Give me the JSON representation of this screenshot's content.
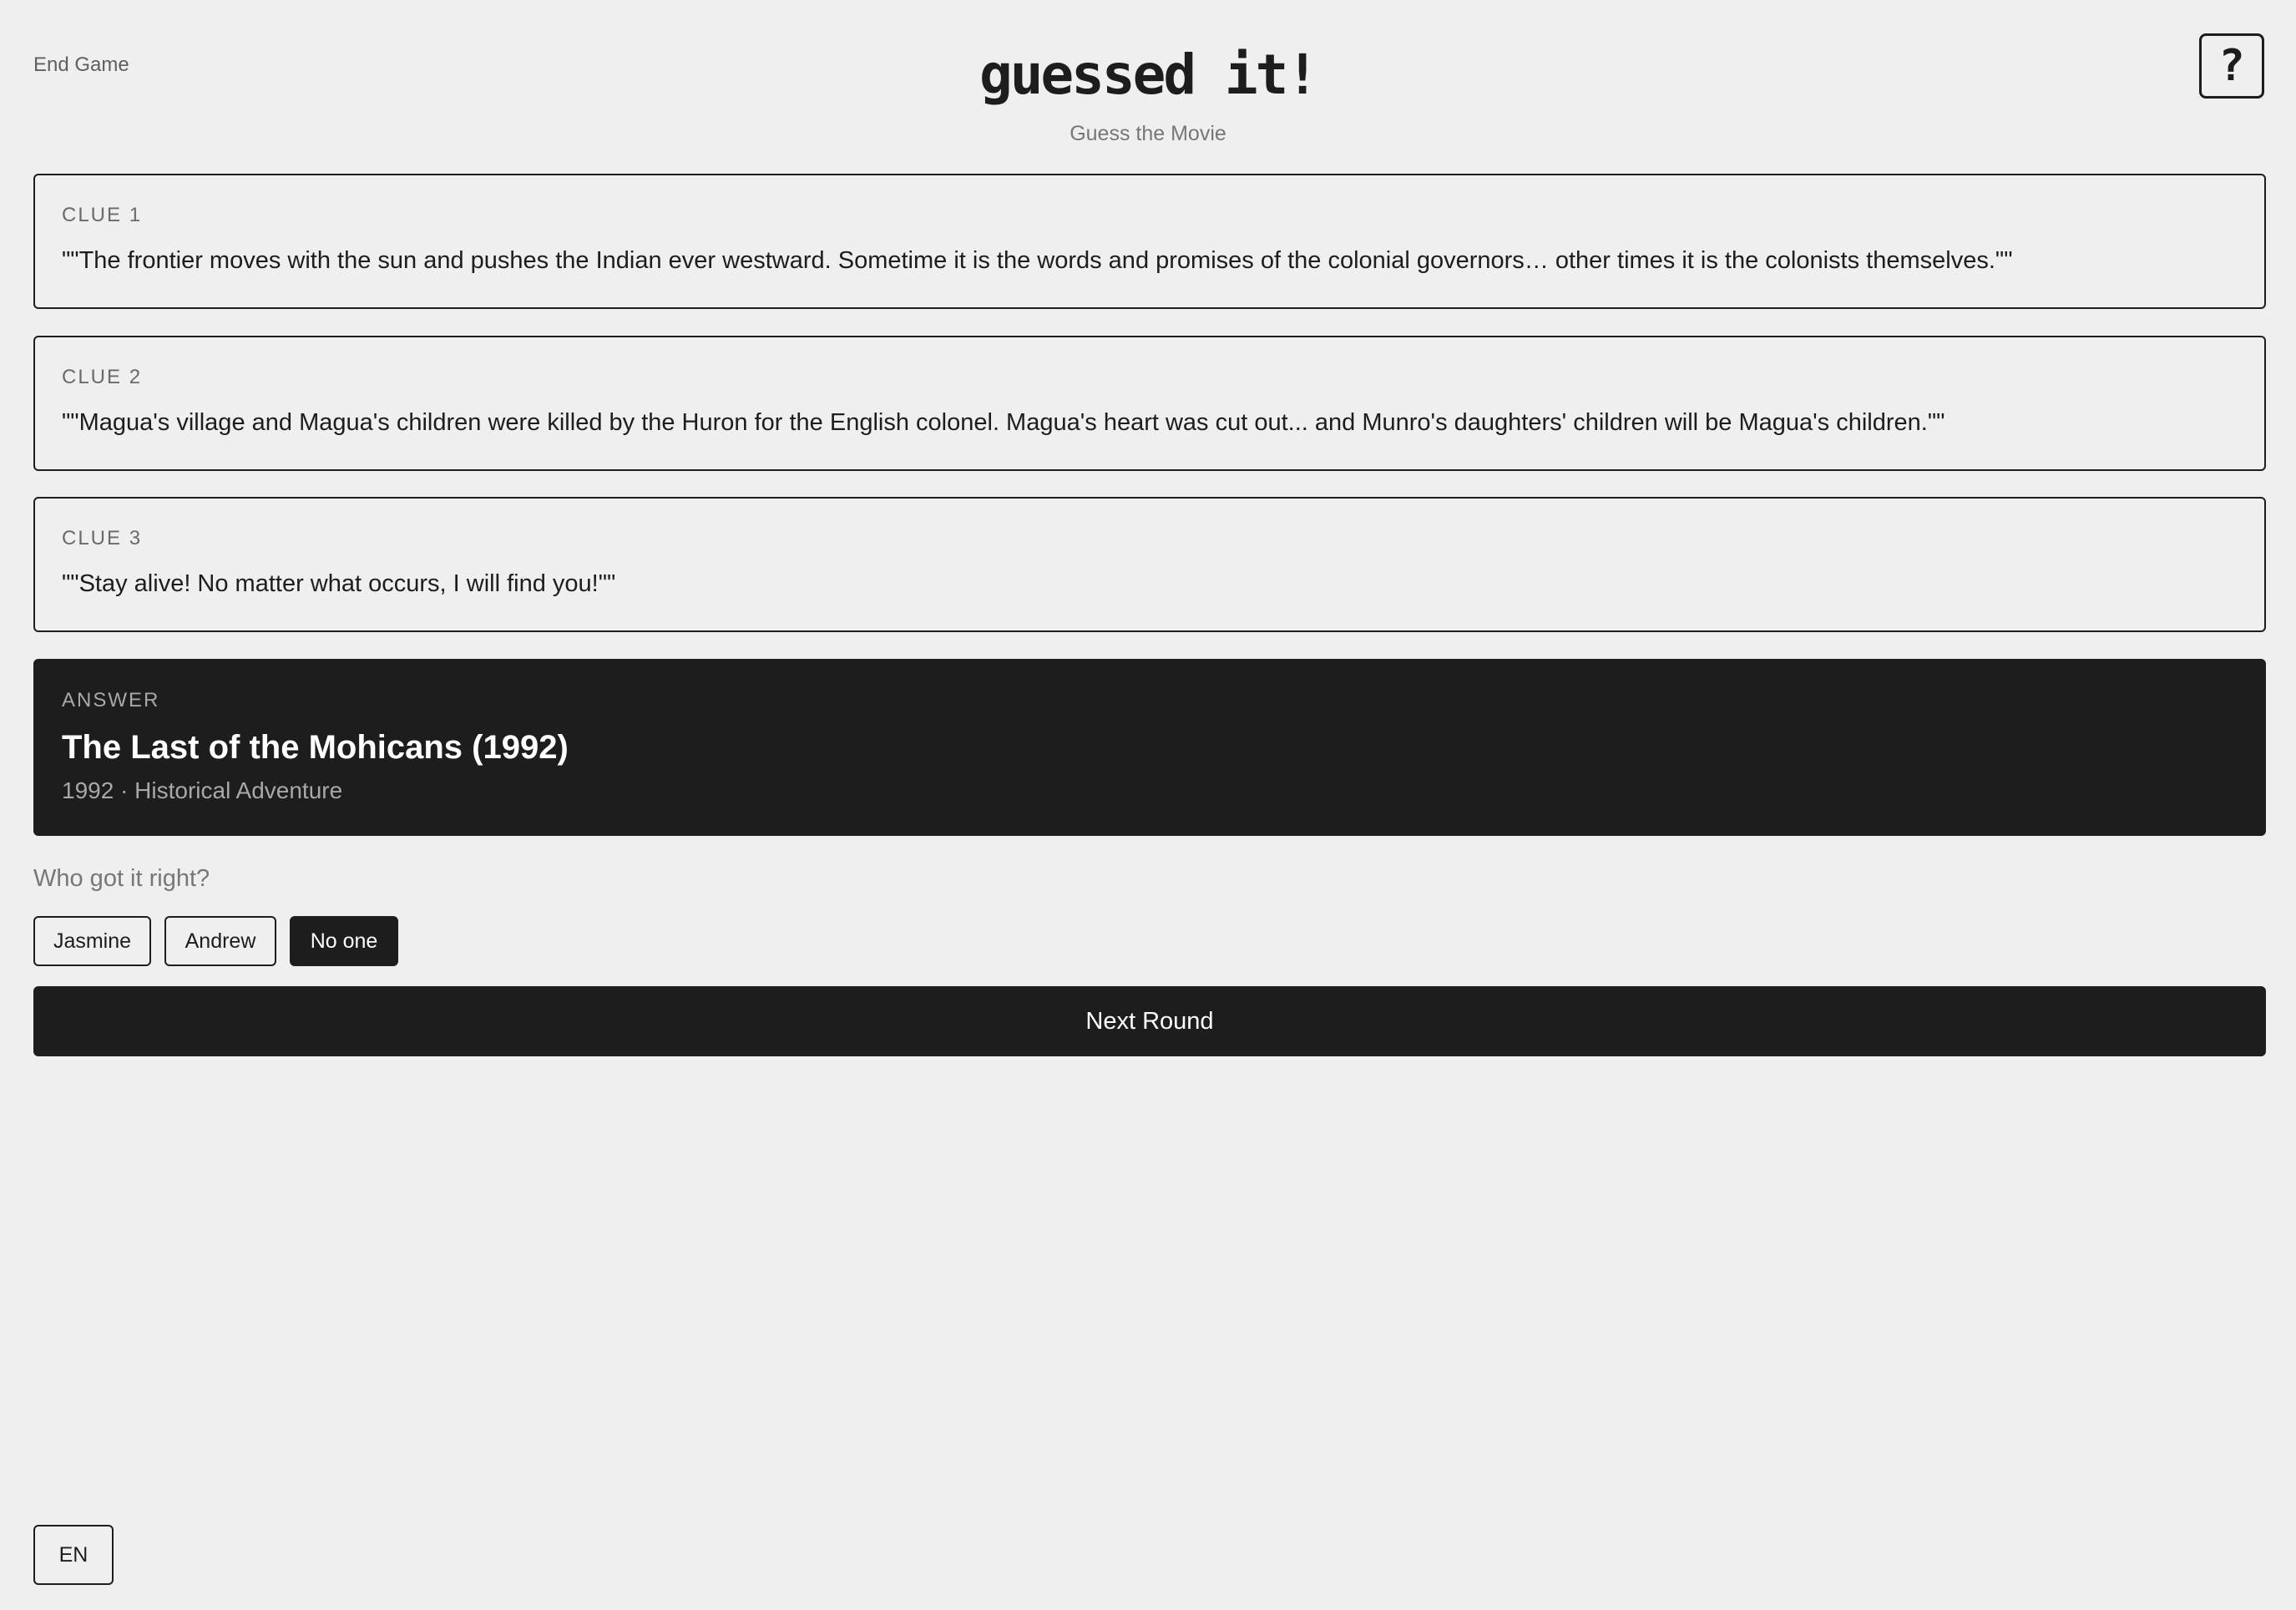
{
  "header": {
    "end_game_label": "End Game",
    "title": "guessed it!",
    "subtitle": "Guess the Movie",
    "help_label": "?"
  },
  "clues": [
    {
      "label": "CLUE 1",
      "text": "\"\"The frontier moves with the sun and pushes the Indian ever westward. Sometime it is the words and promises of the colonial governors… other times it is the colonists themselves.\"\""
    },
    {
      "label": "CLUE 2",
      "text": "\"\"Magua's village and Magua's children were killed by the Huron for the English colonel. Magua's heart was cut out... and Munro's daughters' children will be Magua's children.\"\""
    },
    {
      "label": "CLUE 3",
      "text": "\"\"Stay alive! No matter what occurs, I will find you!\"\""
    }
  ],
  "answer": {
    "label": "ANSWER",
    "title": "The Last of the Mohicans (1992)",
    "meta": "1992 · Historical Adventure"
  },
  "scoring": {
    "question": "Who got it right?",
    "players": [
      {
        "label": "Jasmine",
        "selected": false
      },
      {
        "label": "Andrew",
        "selected": false
      },
      {
        "label": "No one",
        "selected": true
      }
    ]
  },
  "next_round_label": "Next Round",
  "language_label": "EN",
  "colors": {
    "background": "#efefef",
    "dark": "#1d1d1d",
    "muted_text": "#777777"
  }
}
